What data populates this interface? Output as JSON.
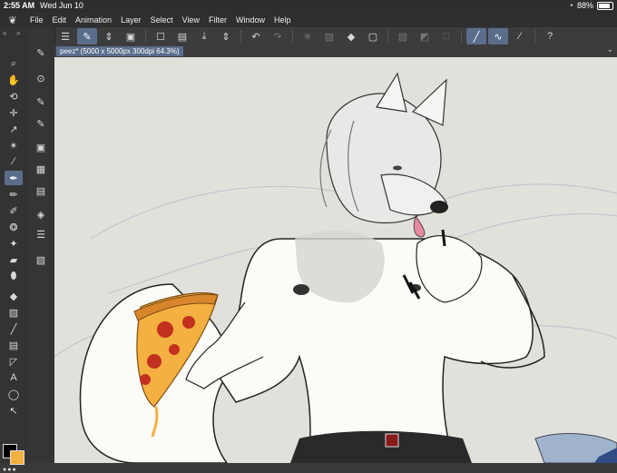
{
  "status": {
    "time": "2:55 AM",
    "date": "Wed Jun 10",
    "battery": "88%"
  },
  "menu": [
    "File",
    "Edit",
    "Animation",
    "Layer",
    "Select",
    "View",
    "Filter",
    "Window",
    "Help"
  ],
  "canvas_tab": {
    "title": "peez* (5000 x 5000px 300dpi 64.3%)"
  },
  "colors": {
    "main": "#000000",
    "sub": "#f4b040",
    "accent": "#5a6e8c"
  },
  "icons": {
    "tools": [
      "zoom-icon",
      "hand-icon",
      "rotate-icon",
      "move-icon",
      "select-icon",
      "wand-icon",
      "eyedropper-icon",
      "pen-icon",
      "pencil-icon",
      "brush-icon",
      "airbrush-icon",
      "decoration-icon",
      "eraser-icon",
      "blend-icon",
      "fill-icon",
      "gradient-icon",
      "line-icon",
      "frame-icon",
      "ruler-icon",
      "text-icon",
      "balloon-icon",
      "correct-line-icon"
    ]
  }
}
